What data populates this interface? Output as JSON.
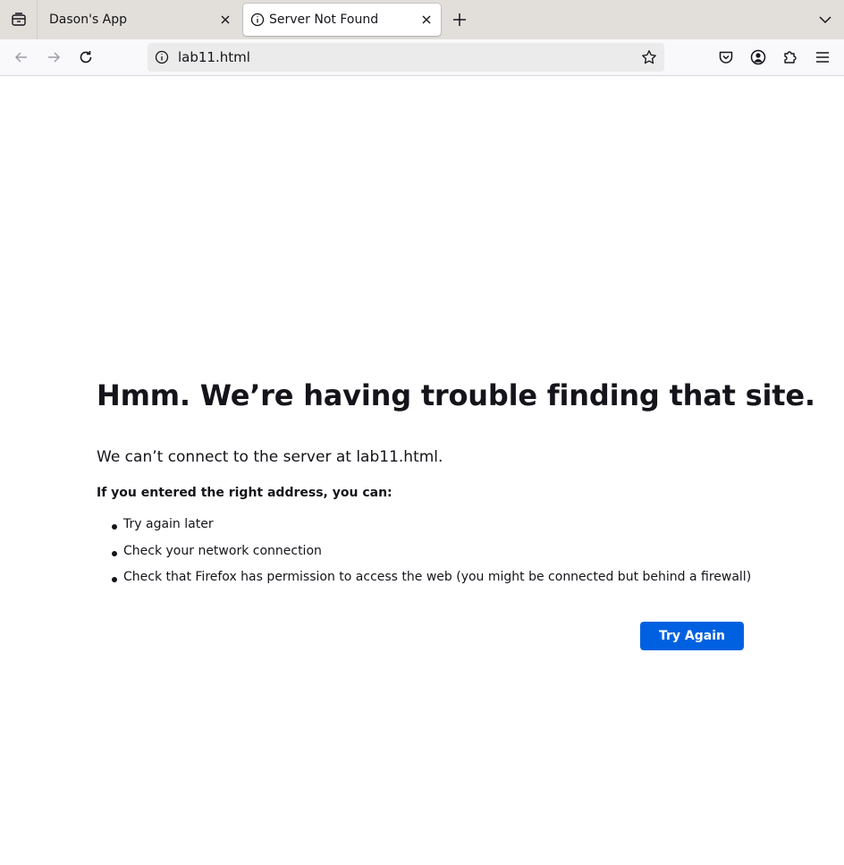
{
  "browser": {
    "tabs": [
      {
        "title": "Dason's App",
        "active": false
      },
      {
        "title": "Server Not Found",
        "active": true
      }
    ],
    "url": "lab11.html"
  },
  "icons": {
    "tab_list": "tab-list-icon",
    "tab_info": "info-icon",
    "tab_close": "close-icon",
    "new_tab": "plus-icon",
    "list_all_tabs": "chevron-down-icon",
    "back": "back-arrow-icon",
    "forward": "forward-arrow-icon",
    "reload": "reload-icon",
    "site_info": "info-icon",
    "bookmark": "star-icon",
    "pocket": "pocket-icon",
    "account": "account-icon",
    "extensions": "puzzle-piece-icon",
    "menu": "hamburger-menu-icon"
  },
  "error_page": {
    "title": "Hmm. We’re having trouble finding that site.",
    "description": "We can’t connect to the server at lab11.html.",
    "subheading": "If you entered the right address, you can:",
    "suggestions": [
      "Try again later",
      "Check your network connection",
      "Check that Firefox has permission to access the web (you might be connected but behind a firewall)"
    ],
    "button_label": "Try Again"
  },
  "colors": {
    "tabbar_bg": "#e2dfda",
    "toolbar_bg": "#f9f9fb",
    "urlbar_bg": "#ebebeb",
    "text": "#15141a",
    "primary_button": "#0061e0"
  }
}
